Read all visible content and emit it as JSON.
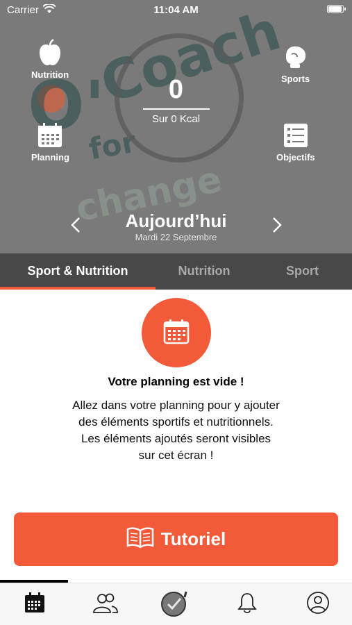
{
  "status_bar": {
    "carrier": "Carrier",
    "time": "11:04 AM"
  },
  "header": {
    "background": "#7a7a7a",
    "watermark": {
      "o": "O'",
      "coach": "Coach",
      "for": "for",
      "change": "change"
    },
    "tiles": {
      "nutrition": {
        "label": "Nutrition",
        "icon": "apple-icon"
      },
      "sports": {
        "label": "Sports",
        "icon": "boxing-glove-icon"
      },
      "planning": {
        "label": "Planning",
        "icon": "calendar-icon"
      },
      "objectifs": {
        "label": "Objectifs",
        "icon": "checklist-icon"
      }
    },
    "kcal": {
      "value": "0",
      "target": "Sur 0 Kcal"
    },
    "date": {
      "title": "Aujourd’hui",
      "subtitle": "Mardi 22 Septembre"
    }
  },
  "tabs": {
    "items": [
      {
        "label": "Sport & Nutrition",
        "active": true
      },
      {
        "label": "Nutrition",
        "active": false
      },
      {
        "label": "Sport",
        "active": false
      }
    ],
    "accent": "#f25a3a"
  },
  "empty_state": {
    "icon": "calendar-icon",
    "title": "Votre planning est vide !",
    "lines": [
      "Allez dans votre planning pour y ajouter",
      "des éléments sportifs et nutritionnels.",
      "Les éléments ajoutés seront visibles",
      "sur cet écran !"
    ]
  },
  "cta": {
    "label": "Tutoriel",
    "icon": "open-book-icon",
    "color": "#f25a3a"
  },
  "bottom_nav": {
    "items": [
      {
        "name": "planning",
        "icon": "calendar-icon",
        "active": true
      },
      {
        "name": "community",
        "icon": "people-icon"
      },
      {
        "name": "coach",
        "icon": "coach-logo-icon"
      },
      {
        "name": "notifications",
        "icon": "bell-icon"
      },
      {
        "name": "profile",
        "icon": "user-icon"
      }
    ]
  }
}
